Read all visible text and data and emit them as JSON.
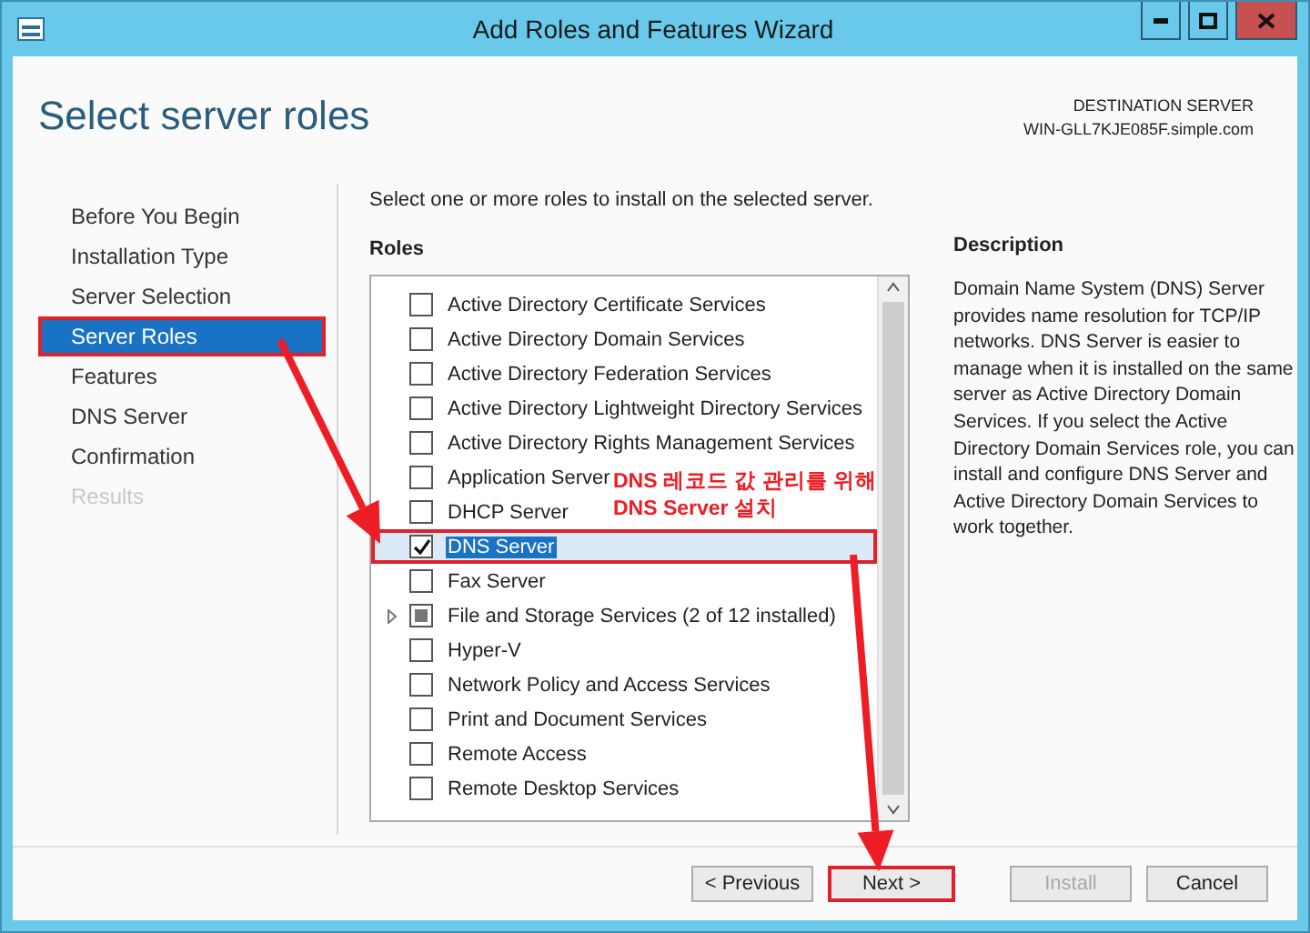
{
  "window": {
    "title": "Add Roles and Features Wizard"
  },
  "page": {
    "title": "Select server roles",
    "destination_label": "DESTINATION SERVER",
    "destination_server": "WIN-GLL7KJE085F.simple.com"
  },
  "nav": [
    {
      "label": "Before You Begin",
      "selected": false,
      "disabled": false,
      "marked": false
    },
    {
      "label": "Installation Type",
      "selected": false,
      "disabled": false,
      "marked": false
    },
    {
      "label": "Server Selection",
      "selected": false,
      "disabled": false,
      "marked": false
    },
    {
      "label": "Server Roles",
      "selected": true,
      "disabled": false,
      "marked": true
    },
    {
      "label": "Features",
      "selected": false,
      "disabled": false,
      "marked": false
    },
    {
      "label": "DNS Server",
      "selected": false,
      "disabled": false,
      "marked": false
    },
    {
      "label": "Confirmation",
      "selected": false,
      "disabled": false,
      "marked": false
    },
    {
      "label": "Results",
      "selected": false,
      "disabled": true,
      "marked": false
    }
  ],
  "intro": "Select one or more roles to install on the selected server.",
  "roles_label": "Roles",
  "roles": [
    {
      "label": "Active Directory Certificate Services",
      "checked": false,
      "selected": false,
      "marked": false
    },
    {
      "label": "Active Directory Domain Services",
      "checked": false,
      "selected": false,
      "marked": false
    },
    {
      "label": "Active Directory Federation Services",
      "checked": false,
      "selected": false,
      "marked": false
    },
    {
      "label": "Active Directory Lightweight Directory Services",
      "checked": false,
      "selected": false,
      "marked": false
    },
    {
      "label": "Active Directory Rights Management Services",
      "checked": false,
      "selected": false,
      "marked": false
    },
    {
      "label": "Application Server",
      "checked": false,
      "selected": false,
      "marked": false
    },
    {
      "label": "DHCP Server",
      "checked": false,
      "selected": false,
      "marked": false
    },
    {
      "label": "DNS Server",
      "checked": true,
      "selected": true,
      "marked": true
    },
    {
      "label": "Fax Server",
      "checked": false,
      "selected": false,
      "marked": false
    },
    {
      "label": "File and Storage Services (2 of 12 installed)",
      "checked": false,
      "partial": true,
      "expandable": true,
      "selected": false,
      "marked": false
    },
    {
      "label": "Hyper-V",
      "checked": false,
      "selected": false,
      "marked": false
    },
    {
      "label": "Network Policy and Access Services",
      "checked": false,
      "selected": false,
      "marked": false
    },
    {
      "label": "Print and Document Services",
      "checked": false,
      "selected": false,
      "marked": false
    },
    {
      "label": "Remote Access",
      "checked": false,
      "selected": false,
      "marked": false
    },
    {
      "label": "Remote Desktop Services",
      "checked": false,
      "selected": false,
      "marked": false
    }
  ],
  "description": {
    "title": "Description",
    "text": "Domain Name System (DNS) Server provides name resolution for TCP/IP networks. DNS Server is easier to manage when it is installed on the same server as Active Directory Domain Services. If you select the Active Directory Domain Services role, you can install and configure DNS Server and Active Directory Domain Services to work together."
  },
  "annotation": "DNS 레코드 값 관리를 위해 DNS Server 설치",
  "buttons": [
    {
      "label": "< Previous",
      "disabled": false,
      "marked": false
    },
    {
      "label": "Next >",
      "disabled": false,
      "marked": true
    },
    {
      "label": "Install",
      "disabled": true,
      "marked": false
    },
    {
      "label": "Cancel",
      "disabled": false,
      "marked": false
    }
  ]
}
